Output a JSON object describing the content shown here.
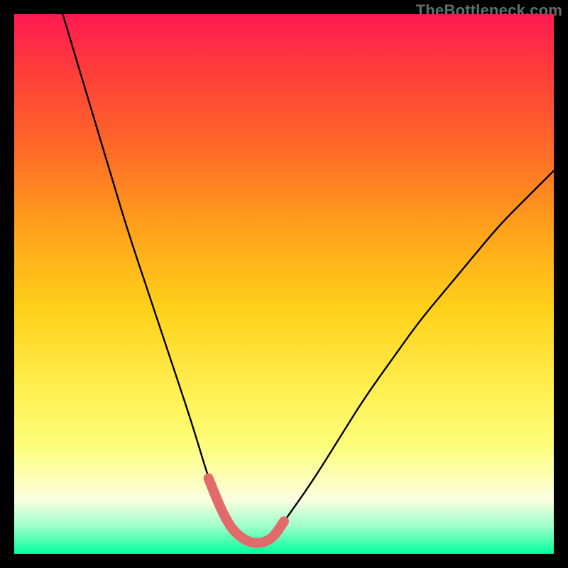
{
  "watermark": "TheBottleneck.com",
  "colors": {
    "curve_black": "#000000",
    "valley_highlight": "#e36a6a"
  },
  "chart_data": {
    "type": "line",
    "title": "",
    "xlabel": "",
    "ylabel": "",
    "xlim": [
      0,
      100
    ],
    "ylim": [
      0,
      100
    ],
    "series": [
      {
        "name": "bottleneck-curve",
        "x": [
          9,
          12,
          15,
          18,
          21,
          25,
          29,
          33,
          36,
          38,
          40,
          42,
          44,
          46,
          48,
          50,
          55,
          60,
          65,
          70,
          75,
          80,
          85,
          90,
          95,
          100
        ],
        "y": [
          100,
          90,
          80,
          70,
          60,
          48,
          36,
          24,
          14,
          9,
          5,
          3,
          2,
          2,
          3,
          6,
          13,
          21,
          29,
          36,
          43,
          49,
          55,
          61,
          66,
          71
        ]
      }
    ],
    "annotations": [
      {
        "name": "valley-highlight",
        "x": [
          36,
          38,
          40,
          42,
          44,
          46,
          48,
          50
        ],
        "y": [
          14,
          9,
          5,
          3,
          2,
          2,
          3,
          6
        ]
      }
    ]
  }
}
